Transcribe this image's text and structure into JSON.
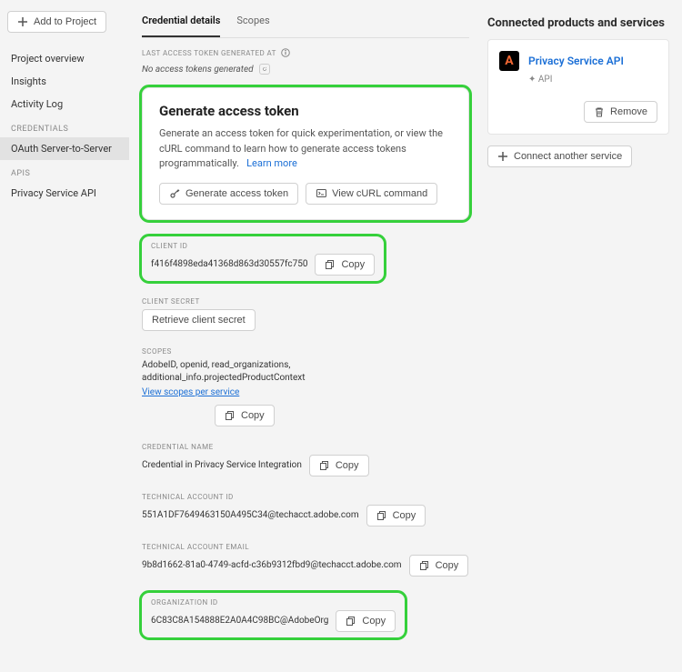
{
  "sidebar": {
    "addToProject": "Add to Project",
    "items": [
      {
        "label": "Project overview"
      },
      {
        "label": "Insights"
      },
      {
        "label": "Activity Log"
      }
    ],
    "credHeader": "CREDENTIALS",
    "credItems": [
      {
        "label": "OAuth Server-to-Server"
      }
    ],
    "apisHeader": "APIS",
    "apiItems": [
      {
        "label": "Privacy Service API"
      }
    ]
  },
  "tabs": [
    {
      "label": "Credential details",
      "active": true
    },
    {
      "label": "Scopes",
      "active": false
    }
  ],
  "tokenGeneratedLabel": "LAST ACCESS TOKEN GENERATED AT",
  "tokenStatus": "No access tokens generated",
  "generateCard": {
    "title": "Generate access token",
    "body": "Generate an access token for quick experimentation, or view the cURL command to learn how to generate access tokens programmatically.",
    "learnMore": "Learn more",
    "genBtn": "Generate access token",
    "curlBtn": "View cURL command"
  },
  "copy": "Copy",
  "clientId": {
    "label": "CLIENT ID",
    "value": "f416f4898eda41368d863d30557fc750"
  },
  "clientSecret": {
    "label": "CLIENT SECRET",
    "btn": "Retrieve client secret"
  },
  "scopes": {
    "label": "SCOPES",
    "value": "AdobeID, openid, read_organizations, additional_info.projectedProductContext",
    "link": "View scopes per service"
  },
  "credName": {
    "label": "CREDENTIAL NAME",
    "value": "Credential in Privacy Service Integration"
  },
  "techAcctId": {
    "label": "TECHNICAL ACCOUNT ID",
    "value": "551A1DF7649463150A495C34@techacct.adobe.com"
  },
  "techAcctEmail": {
    "label": "TECHNICAL ACCOUNT EMAIL",
    "value": "9b8d1662-81a0-4749-acfd-c36b9312fbd9@techacct.adobe.com"
  },
  "orgId": {
    "label": "ORGANIZATION ID",
    "value": "6C83C8A154888E2A0A4C98BC@AdobeOrg"
  },
  "right": {
    "title": "Connected products and services",
    "service": {
      "name": "Privacy Service API",
      "type": "API"
    },
    "remove": "Remove",
    "connectAnother": "Connect another service",
    "iconLetter": "A"
  }
}
